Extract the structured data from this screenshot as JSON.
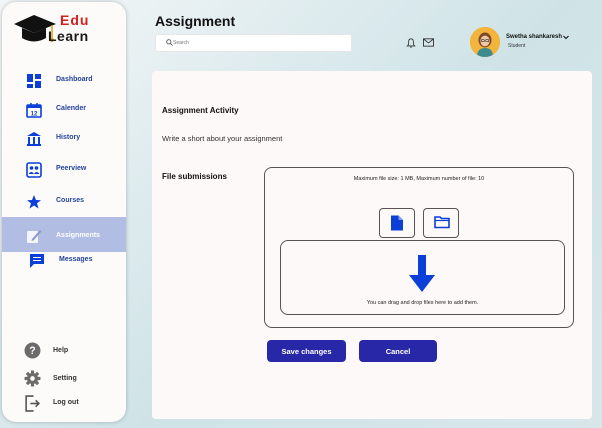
{
  "logo": {
    "line1": "Edu",
    "line2": "Learn"
  },
  "sidebar": {
    "items": [
      {
        "label": "Dashboard",
        "icon": "dashboard-icon"
      },
      {
        "label": "Calender",
        "icon": "calendar-icon"
      },
      {
        "label": "History",
        "icon": "history-icon"
      },
      {
        "label": "Peerview",
        "icon": "peerview-icon"
      },
      {
        "label": "Courses",
        "icon": "star-icon"
      },
      {
        "label": "Assignments",
        "icon": "assignment-icon",
        "active": true
      },
      {
        "label": "Messages",
        "icon": "message-icon"
      }
    ],
    "bottom": [
      {
        "label": "Help",
        "icon": "help-icon"
      },
      {
        "label": "Setting",
        "icon": "gear-icon"
      },
      {
        "label": "Log out",
        "icon": "logout-icon"
      }
    ]
  },
  "header": {
    "title": "Assignment",
    "search_placeholder": "Search",
    "user_name": "Swetha shankaresh",
    "user_role": "Student"
  },
  "main": {
    "activity_title": "Assignment Activity",
    "activity_desc": "Write a short about your assignment",
    "file_label": "File submissions",
    "file_info": "Maximum file size: 1 MB, Maximum number of file: 10",
    "drop_text": "You can drag and drop files here to add them.",
    "save_label": "Save changes",
    "cancel_label": "Cancel"
  },
  "colors": {
    "accent": "#2727a8",
    "nav_text": "#23449c",
    "active_bg": "#b2bde3",
    "icon_blue": "#0b3fd8",
    "logo_red": "#d41f1f"
  }
}
